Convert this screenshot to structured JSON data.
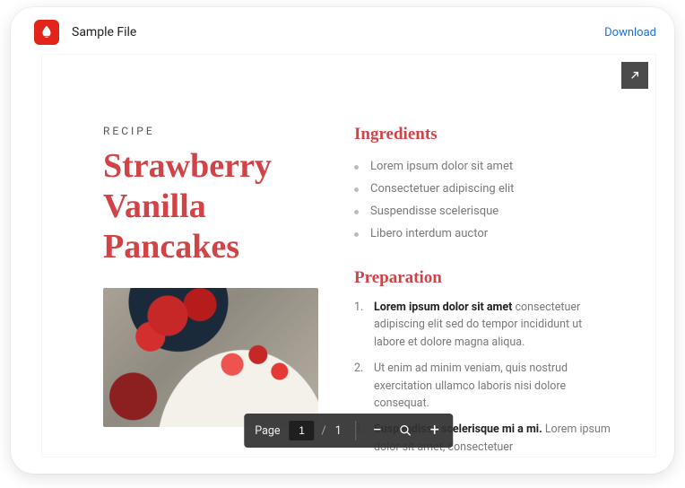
{
  "header": {
    "title": "Sample File",
    "download_label": "Download"
  },
  "document": {
    "kicker": "RECIPE",
    "title": "Strawberry Vanilla Pancakes",
    "ingredients_heading": "Ingredients",
    "ingredients": [
      "Lorem ipsum dolor sit amet",
      "Consectetuer adipiscing elit",
      "Suspendisse scelerisque",
      "Libero interdum auctor"
    ],
    "preparation_heading": "Preparation",
    "preparation": [
      {
        "strong": "Lorem ipsum dolor sit amet",
        "rest": " consectetuer adipiscing elit sed do tempor incididunt ut labore et dolore magna aliqua."
      },
      {
        "strong": "",
        "rest": "Ut enim ad minim veniam, quis nostrud exercitation ullamco laboris nisi dolore consequat."
      },
      {
        "strong": "Suspendisse scelerisque mi a mi.",
        "rest": " Lorem ipsum dolor sit amet, consectetuer"
      }
    ]
  },
  "toolbar": {
    "page_label": "Page",
    "current_page": "1",
    "sep": "/",
    "total_pages": "1"
  },
  "colors": {
    "accent": "#d24348",
    "link": "#1473e6"
  }
}
